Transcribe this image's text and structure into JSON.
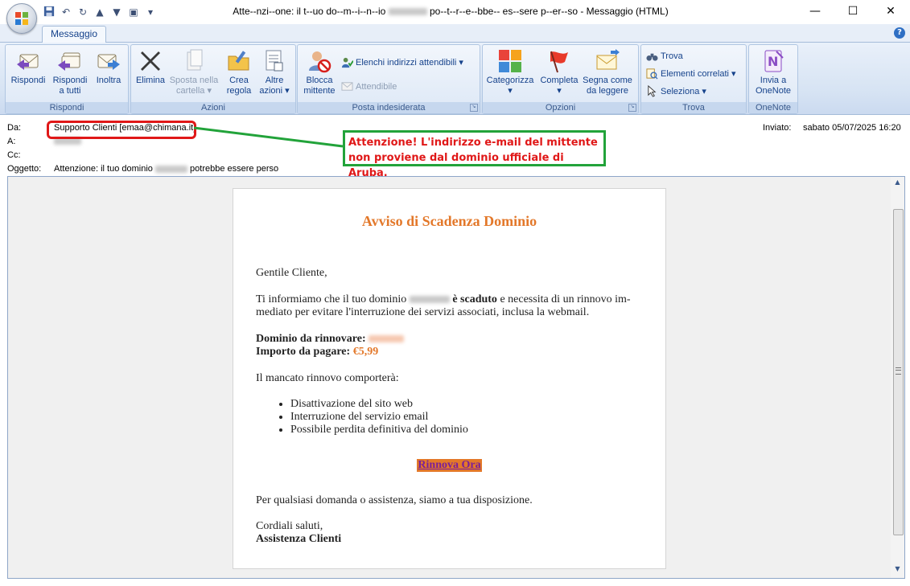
{
  "window": {
    "title": "Atte--nzi--one: il t--uo do--m--i--n--io",
    "title_tail": "po--t--r--e--bbe-- es--sere p--er--so - Messaggio (HTML)",
    "minimize": "—",
    "maximize": "☐",
    "close": "✕"
  },
  "tabs": [
    {
      "label": "Messaggio"
    }
  ],
  "ribbon": {
    "groups": {
      "rispondi": "Rispondi",
      "azioni": "Azioni",
      "posta_indesiderata": "Posta indesiderata",
      "opzioni": "Opzioni",
      "trova": "Trova",
      "onenote": "OneNote"
    },
    "buttons": {
      "rispondi": "Rispondi",
      "rispondi_tutti_1": "Rispondi",
      "rispondi_tutti_2": "a tutti",
      "inoltra": "Inoltra",
      "elimina": "Elimina",
      "sposta_1": "Sposta nella",
      "sposta_2": "cartella",
      "crea_regola_1": "Crea",
      "crea_regola_2": "regola",
      "altre_azioni_1": "Altre",
      "altre_azioni_2": "azioni",
      "blocca_1": "Blocca",
      "blocca_2": "mittente",
      "elenchi": "Elenchi indirizzi attendibili",
      "attendibile": "Attendibile",
      "categorizza": "Categorizza",
      "completa": "Completa",
      "segna_1": "Segna come",
      "segna_2": "da leggere",
      "trova": "Trova",
      "elementi_correlati": "Elementi correlati",
      "seleziona": "Seleziona",
      "invia_onenote_1": "Invia a",
      "invia_onenote_2": "OneNote"
    }
  },
  "header": {
    "from_label": "Da:",
    "from_value": "Supporto Clienti [emaa@chimana.it]",
    "to_label": "A:",
    "cc_label": "Cc:",
    "subject_label": "Oggetto:",
    "subject_pre": "Attenzione: il tuo dominio",
    "subject_post": "potrebbe essere perso",
    "sent_label": "Inviato:",
    "sent_value": "sabato 05/07/2025 16:20"
  },
  "annotation": {
    "text": "Attenzione! L'indirizzo e-mail del mittente non proviene dal dominio ufficiale di Aruba.",
    "color": "#e01818",
    "border_color": "#22a33a"
  },
  "email": {
    "title": "Avviso di Scadenza Dominio",
    "greeting": "Gentile Cliente,",
    "intro_pre": "Ti informiamo che il tuo dominio",
    "intro_bold": "è scaduto",
    "intro_post": "e necessita di un rinnovo im-",
    "intro_line2": "mediato per evitare l'interruzione dei servizi associati, inclusa la webmail.",
    "domain_label": "Dominio da rinnovare:",
    "amount_label": "Importo da pagare:",
    "amount_value": "€5,99",
    "consequence_intro": "Il mancato rinnovo comporterà:",
    "consequences": [
      "Disattivazione del sito web",
      "Interruzione del servizio email",
      "Possibile perdita definitiva del dominio"
    ],
    "cta": "Rinnova Ora",
    "help": "Per qualsiasi domanda o assistenza, siamo a tua disposizione.",
    "closing": "Cordiali saluti,",
    "signature": "Assistenza Clienti",
    "accent_color": "#e3782a"
  }
}
